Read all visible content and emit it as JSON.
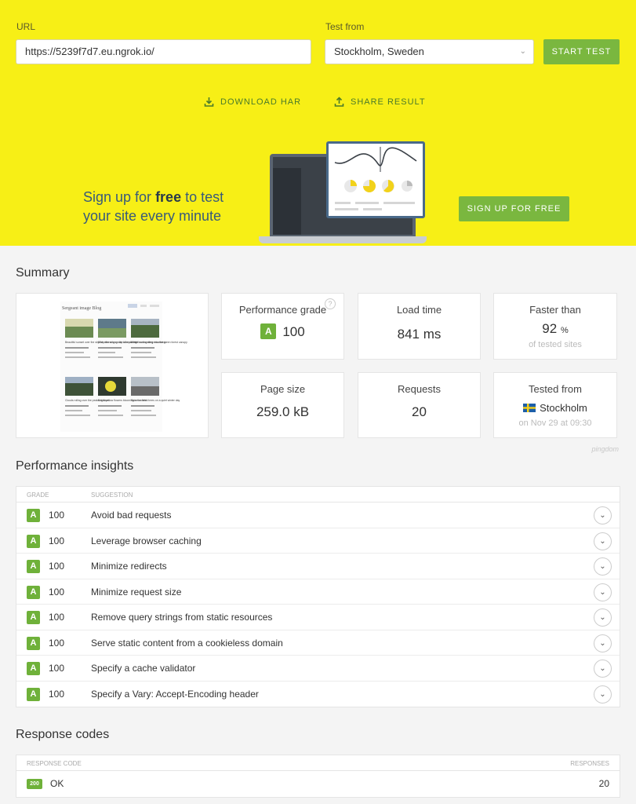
{
  "test_form": {
    "url_label": "URL",
    "url_value": "https://5239f7d7.eu.ngrok.io/",
    "from_label": "Test from",
    "from_value": "Stockholm, Sweden",
    "start_label": "START TEST"
  },
  "actions": {
    "download_label": "DOWNLOAD HAR",
    "share_label": "SHARE RESULT"
  },
  "signup": {
    "line1_pre": "Sign up for ",
    "line1_bold": "free",
    "line1_post": " to test",
    "line2": "your site every minute",
    "button": "SIGN UP FOR FREE"
  },
  "summary": {
    "title": "Summary",
    "performance_grade": {
      "title": "Performance grade",
      "grade": "A",
      "value": "100"
    },
    "load_time": {
      "title": "Load time",
      "value": "841 ms"
    },
    "faster_than": {
      "title": "Faster than",
      "value": "92",
      "unit": "%",
      "sub": "of tested sites"
    },
    "page_size": {
      "title": "Page size",
      "value": "259.0 kB"
    },
    "requests": {
      "title": "Requests",
      "value": "20"
    },
    "tested_from": {
      "title": "Tested from",
      "value": "Stockholm",
      "sub": "on Nov 29 at 09:30"
    },
    "credit": "pingdom",
    "thumbnail": {
      "site_title": "Sergeant image Blog",
      "captions": [
        "Beautiful sunset over the skyline after a long day of exploring",
        "Misty morning on the lake with the surrounding mountains",
        "A trail leading deep into the green forest canopy",
        "Clouds rolling over the peaks at dawn",
        "Bright yellow flowers blooming in the field",
        "Snow covered trees on a quiet winter day"
      ]
    }
  },
  "insights": {
    "title": "Performance insights",
    "col_grade": "GRADE",
    "col_suggestion": "SUGGESTION",
    "rows": [
      {
        "grade": "A",
        "score": "100",
        "suggestion": "Avoid bad requests"
      },
      {
        "grade": "A",
        "score": "100",
        "suggestion": "Leverage browser caching"
      },
      {
        "grade": "A",
        "score": "100",
        "suggestion": "Minimize redirects"
      },
      {
        "grade": "A",
        "score": "100",
        "suggestion": "Minimize request size"
      },
      {
        "grade": "A",
        "score": "100",
        "suggestion": "Remove query strings from static resources"
      },
      {
        "grade": "A",
        "score": "100",
        "suggestion": "Serve static content from a cookieless domain"
      },
      {
        "grade": "A",
        "score": "100",
        "suggestion": "Specify a cache validator"
      },
      {
        "grade": "A",
        "score": "100",
        "suggestion": "Specify a Vary: Accept-Encoding header"
      }
    ]
  },
  "response_codes": {
    "title": "Response codes",
    "col_code": "RESPONSE CODE",
    "col_responses": "RESPONSES",
    "rows": [
      {
        "code": "200",
        "label": "OK",
        "count": "20"
      }
    ]
  },
  "icons": {
    "download": "download-icon",
    "share": "share-icon",
    "select_caret": "chevron-down-icon",
    "expand": "chevron-down-icon",
    "help": "question-icon",
    "flag": "sweden-flag-icon"
  },
  "colors": {
    "hero_bg": "#f7ef16",
    "accent_green": "#7ab73f",
    "grade_green": "#6fb13a"
  }
}
